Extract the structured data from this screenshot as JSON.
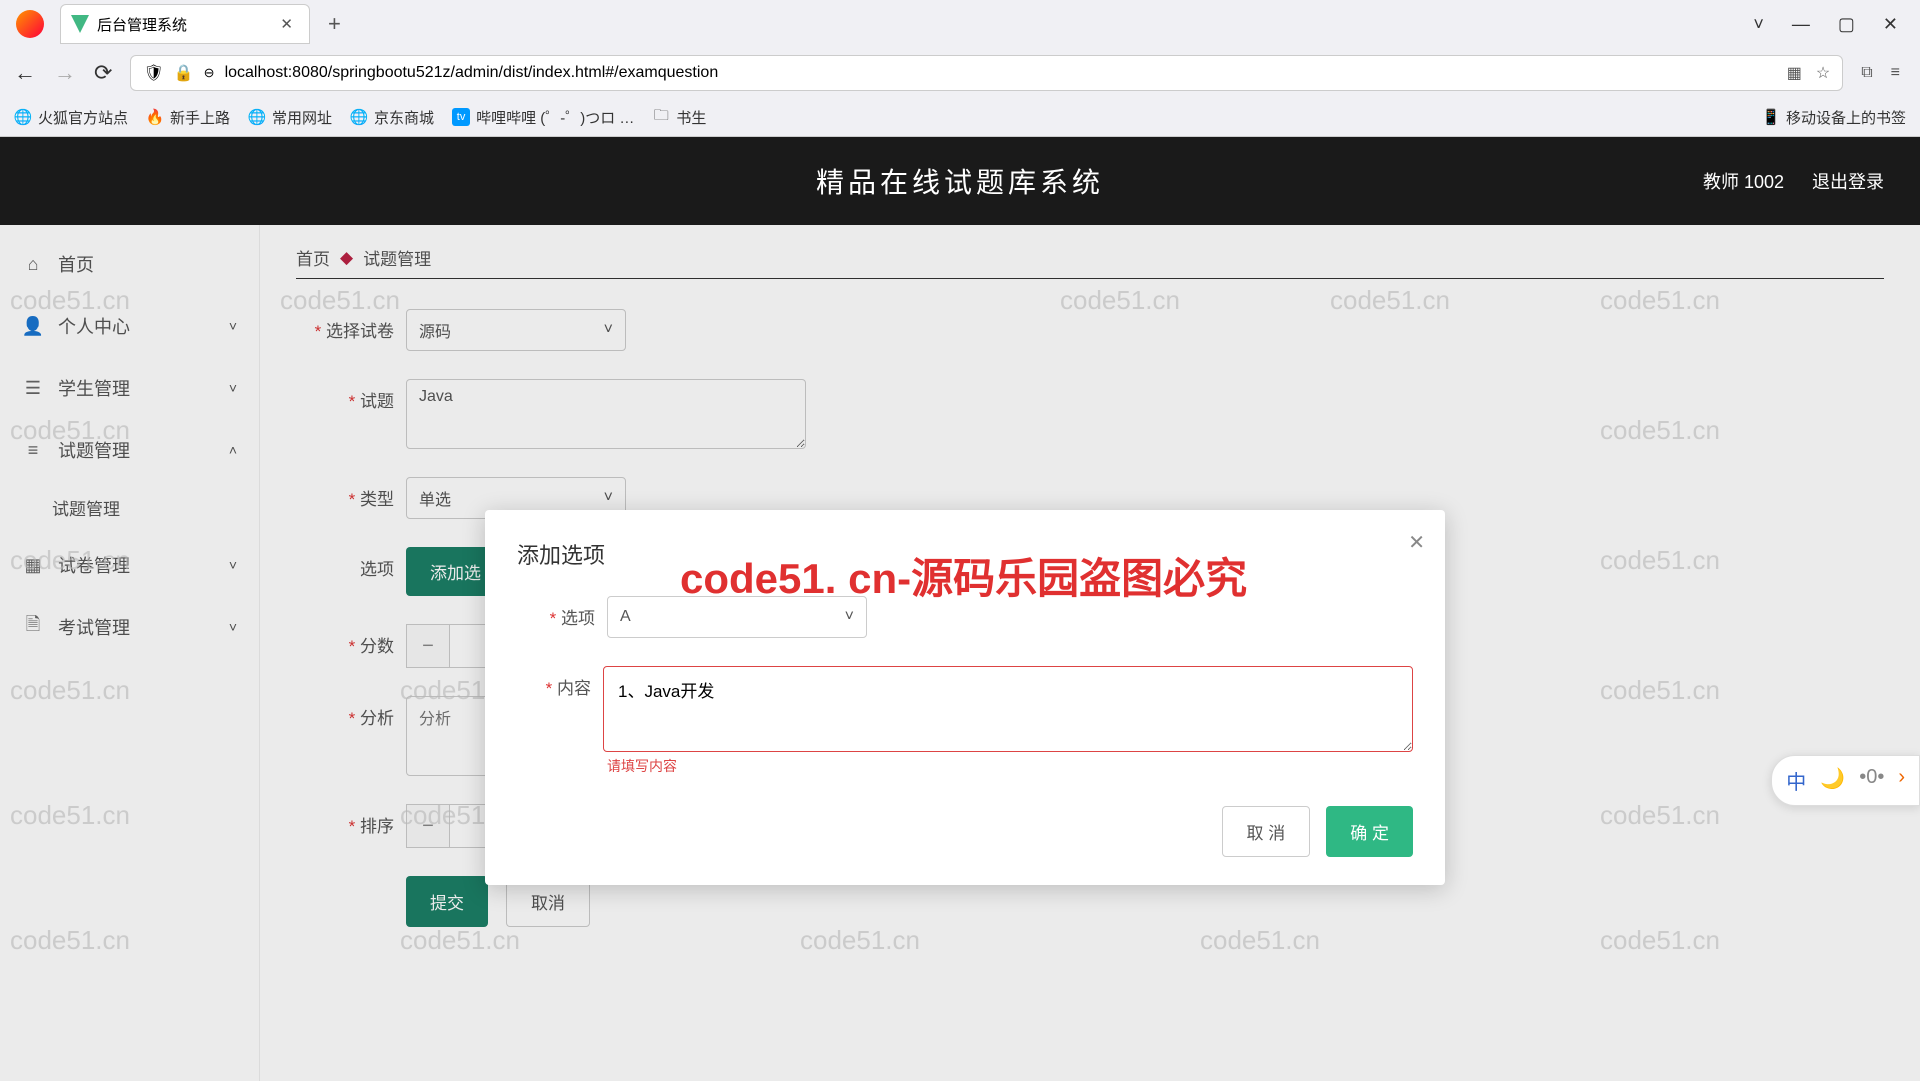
{
  "browser": {
    "tab_title": "后台管理系统",
    "url": "localhost:8080/springbootu521z/admin/dist/index.html#/examquestion",
    "window_controls": {
      "minimize": "—",
      "maximize": "▢",
      "close": "✕"
    },
    "bookmarks": [
      "火狐官方站点",
      "新手上路",
      "常用网址",
      "京东商城",
      "哔哩哔哩 (゜-゜)つロ …",
      "书生"
    ],
    "mobile_bookmark": "移动设备上的书签"
  },
  "header": {
    "title": "精品在线试题库系统",
    "user": "教师 1002",
    "logout": "退出登录"
  },
  "sidebar": {
    "items": [
      {
        "label": "首页",
        "icon": "home"
      },
      {
        "label": "个人中心",
        "icon": "user",
        "chev": "˅"
      },
      {
        "label": "学生管理",
        "icon": "bars",
        "chev": "˅"
      },
      {
        "label": "试题管理",
        "icon": "list",
        "chev": "˄",
        "sub": [
          "试题管理"
        ]
      },
      {
        "label": "试卷管理",
        "icon": "grid",
        "chev": "˅"
      },
      {
        "label": "考试管理",
        "icon": "doc",
        "chev": "˅"
      }
    ]
  },
  "breadcrumb": {
    "home": "首页",
    "current": "试题管理"
  },
  "form": {
    "labels": {
      "select_paper": "选择试卷",
      "question": "试题",
      "type": "类型",
      "options": "选项",
      "score": "分数",
      "analysis": "分析",
      "order": "排序"
    },
    "select_paper_value": "源码",
    "question_value": "Java",
    "type_value": "单选",
    "add_option_btn": "添加选",
    "analysis_placeholder": "分析",
    "submit": "提交",
    "cancel": "取消"
  },
  "modal": {
    "title": "添加选项",
    "labels": {
      "option": "选项",
      "content": "内容"
    },
    "option_value": "A",
    "content_value": "1、Java开发",
    "error": "请填写内容",
    "cancel": "取 消",
    "ok": "确 定"
  },
  "watermark": {
    "gray": "code51.cn",
    "red": "code51. cn-源码乐园盗图必究"
  },
  "ime": {
    "lang": "中",
    "moon": "🌙",
    "more": "•0•",
    "arrow": "›"
  }
}
